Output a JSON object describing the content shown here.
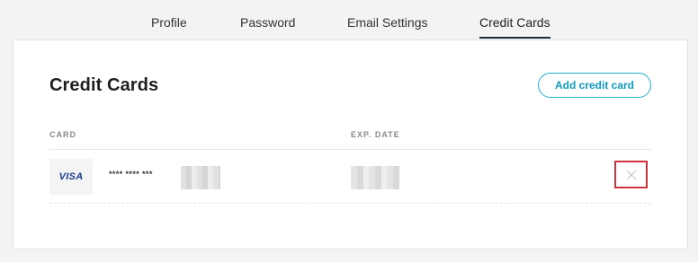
{
  "tabs": [
    {
      "label": "Profile"
    },
    {
      "label": "Password"
    },
    {
      "label": "Email Settings"
    },
    {
      "label": "Credit Cards",
      "active": true
    }
  ],
  "section": {
    "title": "Credit Cards",
    "add_button": "Add credit card"
  },
  "table": {
    "columns": [
      "CARD",
      "EXP. DATE"
    ],
    "rows": [
      {
        "brand": "VISA",
        "card_number": "**** **** ***",
        "exp_date": "",
        "delete_icon": "close-icon"
      }
    ]
  },
  "colors": {
    "accent": "#0f9bbf",
    "highlight": "#d0343a",
    "active_tab_underline": "#1d2b3a"
  }
}
